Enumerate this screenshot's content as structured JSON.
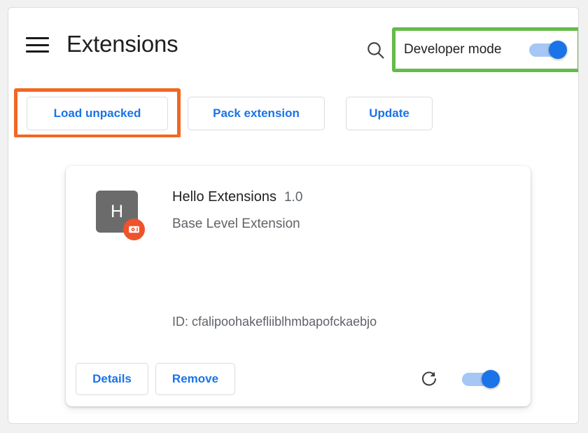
{
  "toolbar": {
    "menu_icon": "hamburger-menu-icon",
    "title": "Extensions",
    "search_icon": "search-icon",
    "developer_mode_label": "Developer mode",
    "developer_mode_enabled": true
  },
  "actions": {
    "load_unpacked_label": "Load unpacked",
    "pack_extension_label": "Pack extension",
    "update_label": "Update"
  },
  "highlights": {
    "developer_mode_box_color": "#66bb4a",
    "load_unpacked_box_color": "#f26722"
  },
  "extension": {
    "icon_letter": "H",
    "icon_background": "#6b6b6b",
    "badge_icon": "unpacked-extension-icon",
    "badge_color": "#f0522a",
    "name": "Hello Extensions",
    "version": "1.0",
    "description": "Base Level Extension",
    "id_text": "ID: cfalipoohakefliiblhmbapofckaebjo",
    "details_label": "Details",
    "remove_label": "Remove",
    "reload_icon": "reload-icon",
    "enabled": true
  },
  "colors": {
    "accent_blue": "#1a73e8",
    "toggle_track": "#a6c6f5",
    "page_background": "#ffffff",
    "surround_background": "#f1f1f2"
  }
}
